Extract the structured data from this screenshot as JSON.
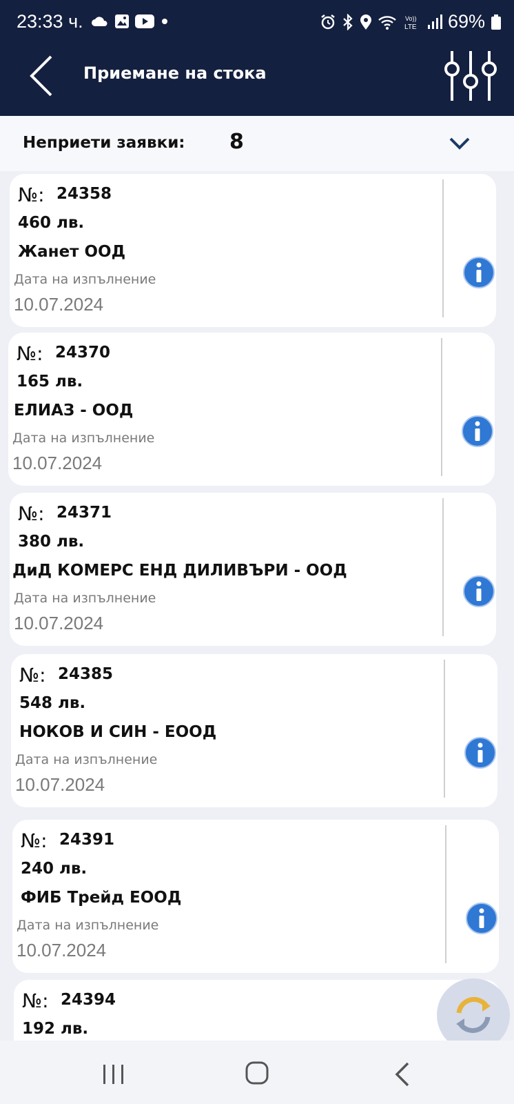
{
  "status_bar": {
    "time": "23:33 ч.",
    "battery": "69%"
  },
  "header": {
    "title": "Приемане на стока"
  },
  "pending": {
    "label": "Неприети заявки:",
    "count": "8"
  },
  "orders": [
    {
      "no_sign": "№:",
      "number": "24358",
      "amount": "460 лв.",
      "company": "Жанет ООД",
      "date_label": "Дата на изпълнение",
      "date": "10.07.2024"
    },
    {
      "no_sign": "№:",
      "number": "24370",
      "amount": "165 лв.",
      "company": "ЕЛИАЗ - ООД",
      "date_label": "Дата на изпълнение",
      "date": "10.07.2024"
    },
    {
      "no_sign": "№:",
      "number": "24371",
      "amount": "380 лв.",
      "company": "ДиД КОМЕРС ЕНД  ДИЛИВЪРИ - ООД",
      "date_label": "Дата на изпълнение",
      "date": "10.07.2024"
    },
    {
      "no_sign": "№:",
      "number": "24385",
      "amount": "548 лв.",
      "company": "НОКОВ И СИН - ЕООД",
      "date_label": "Дата на изпълнение",
      "date": "10.07.2024"
    },
    {
      "no_sign": "№:",
      "number": "24391",
      "amount": "240 лв.",
      "company": "ФИБ Трейд ЕООД",
      "date_label": "Дата на изпълнение",
      "date": "10.07.2024"
    },
    {
      "no_sign": "№:",
      "number": "24394",
      "amount": "192 лв.",
      "company": "",
      "date_label": "",
      "date": ""
    }
  ],
  "colors": {
    "header_bg": "#14203f",
    "info_blue": "#2f78d4",
    "text_gray": "#7a7a7a"
  }
}
